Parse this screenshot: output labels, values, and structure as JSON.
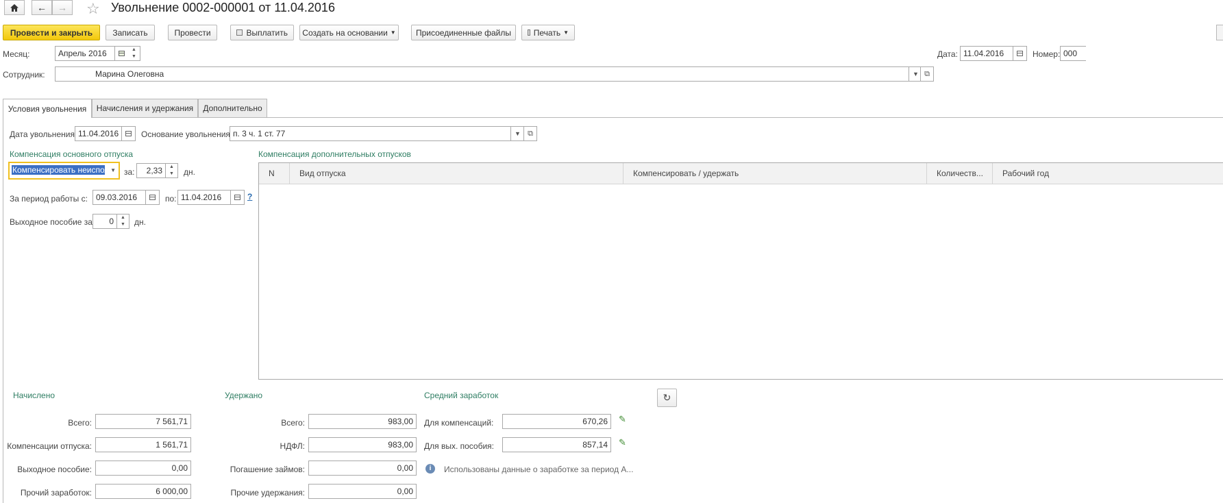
{
  "header": {
    "title": "Увольнение 0002-000001 от 11.04.2016"
  },
  "toolbar": {
    "post_close": "Провести и закрыть",
    "save": "Записать",
    "post": "Провести",
    "pay": "Выплатить",
    "create_based": "Создать на основании",
    "attached_files": "Присоединенные файлы",
    "print": "Печать"
  },
  "form": {
    "month_label": "Месяц:",
    "month_value": "Апрель 2016",
    "date_label": "Дата:",
    "date_value": "11.04.2016",
    "number_label": "Номер:",
    "number_value": "000",
    "employee_label": "Сотрудник:",
    "employee_value": "Марина Олеговна"
  },
  "tabs": [
    {
      "label": "Условия увольнения"
    },
    {
      "label": "Начисления и удержания"
    },
    {
      "label": "Дополнительно"
    }
  ],
  "conditions": {
    "dismissal_date_label": "Дата увольнения:",
    "dismissal_date_value": "11.04.2016",
    "reason_label": "Основание увольнения:",
    "reason_value": "п. 3 ч. 1 ст. 77",
    "main_comp_title": "Компенсация основного отпуска",
    "main_comp_mode": "Компенсировать неиспол",
    "for_label": "за:",
    "days_value": "2,33",
    "days_unit": "дн.",
    "period_label": "За период работы с:",
    "period_from": "09.03.2016",
    "period_to_label": "по:",
    "period_to": "11.04.2016",
    "help": "?",
    "severance_label": "Выходное пособие за:",
    "severance_value": "0",
    "severance_unit": "дн."
  },
  "extra_comp": {
    "title": "Компенсация дополнительных отпусков",
    "columns": [
      "N",
      "Вид отпуска",
      "Компенсировать / удержать",
      "Количеств...",
      "Рабочий год"
    ]
  },
  "accrued": {
    "title": "Начислено",
    "total_label": "Всего:",
    "total_value": "7 561,71",
    "vacation_comp_label": "Компенсации отпуска:",
    "vacation_comp_value": "1 561,71",
    "severance_label": "Выходное пособие:",
    "severance_value": "0,00",
    "other_label": "Прочий заработок:",
    "other_value": "6 000,00"
  },
  "withheld": {
    "title": "Удержано",
    "total_label": "Всего:",
    "total_value": "983,00",
    "ndfl_label": "НДФЛ:",
    "ndfl_value": "983,00",
    "loans_label": "Погашение займов:",
    "loans_value": "0,00",
    "other_label": "Прочие удержания:",
    "other_value": "0,00"
  },
  "avg": {
    "title": "Средний заработок",
    "comp_label": "Для компенсаций:",
    "comp_value": "670,26",
    "sev_label": "Для вых. пособия:",
    "sev_value": "857,14",
    "info_text": "Использованы данные о заработке за период А..."
  },
  "icons": {
    "home": "home-icon",
    "back": "arrow-left-icon",
    "forward": "arrow-right-icon",
    "star": "star-icon",
    "refresh": "refresh-icon",
    "info": "info-icon",
    "pencil": "pencil-icon",
    "calendar": "calendar-icon",
    "printer": "printer-icon",
    "money": "money-icon"
  },
  "colors": {
    "primary_button": "#f2c80b",
    "section_title": "#2e7d62",
    "selection": "#3b6fc4",
    "focus_border": "#f0c020"
  }
}
